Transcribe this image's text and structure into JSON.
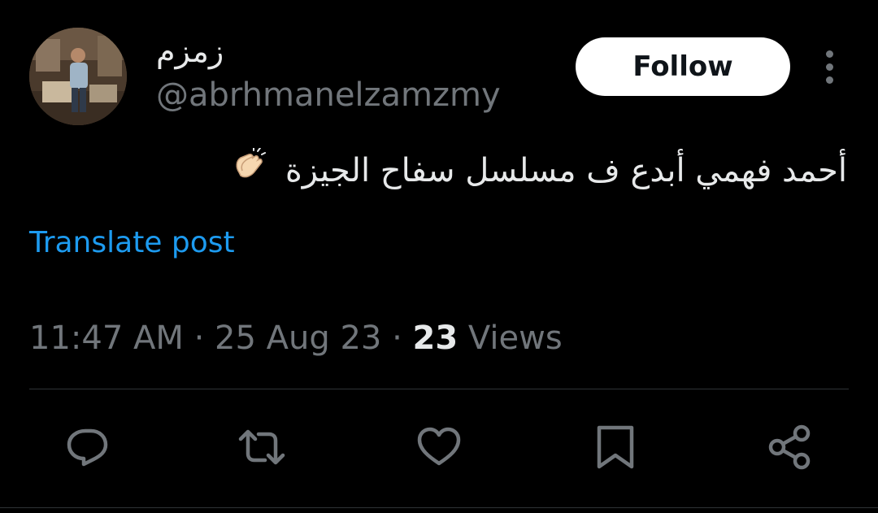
{
  "author": {
    "display_name": "زمزم",
    "handle": "@abrhmanelzamzmy"
  },
  "follow_label": "Follow",
  "post": {
    "text": "أحمد فهمي أبدع ف مسلسل سفاح الجيزة",
    "emoji": "clapping-hands-icon"
  },
  "translate_label": "Translate post",
  "meta": {
    "time": "11:47 AM",
    "separator": "·",
    "date": "25 Aug 23",
    "views_count": "23",
    "views_label": "Views"
  },
  "actions": [
    "reply-icon",
    "repost-icon",
    "like-icon",
    "bookmark-icon",
    "share-icon"
  ],
  "colors": {
    "background": "#000000",
    "text_primary": "#e7e9ea",
    "text_secondary": "#71767b",
    "link": "#1d9bf0",
    "divider": "#2f3336",
    "follow_bg": "#ffffff",
    "follow_text": "#0f1419"
  }
}
